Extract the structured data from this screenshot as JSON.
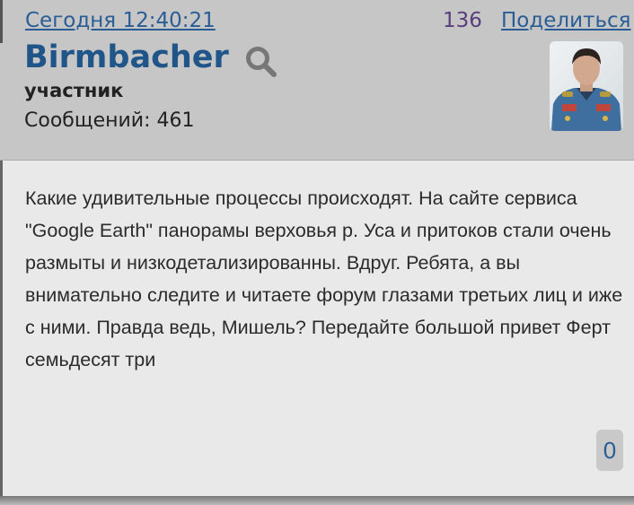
{
  "post": {
    "timestamp": "Сегодня 12:40:21",
    "number": "136",
    "share_label": "Поделиться",
    "author": {
      "name": "Birmbacher",
      "role": "участник",
      "messages": "Сообщений: 461"
    },
    "text": "Какие удивительные процессы происходят. На сайте сервиса \"Google Earth\" панорамы верховья р. Уса и притоков стали очень размыты и низкодетализированны. Вдруг. Ребята, а вы внимательно следите и читаете форум глазами третьих лиц и иже с ними. Правда ведь, Мишель? Передайте большой привет Ферт семьдесят три",
    "likes": "0"
  },
  "icons": {
    "search": "search-icon",
    "avatar": "avatar-portrait"
  },
  "colors": {
    "link": "#2a5d95",
    "username": "#1f5588",
    "header_bg": "#c6c6c6",
    "body_bg": "#e9e9e9"
  }
}
